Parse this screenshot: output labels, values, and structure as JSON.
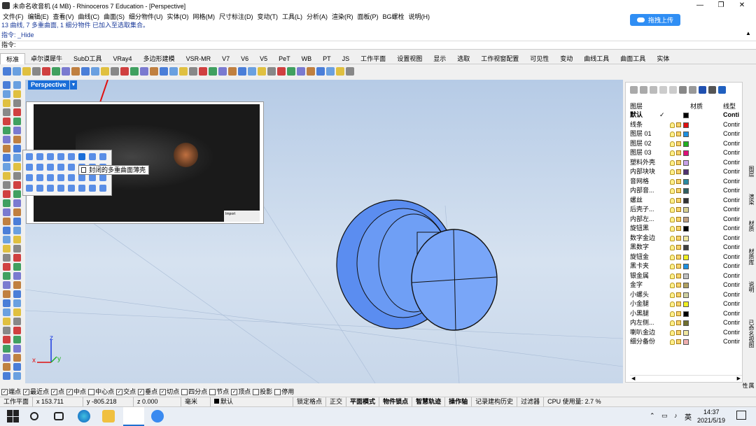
{
  "window": {
    "title": "未命名收音机 (4 MB) - Rhinoceros 7 Education - [Perspective]"
  },
  "menu": [
    "文件(F)",
    "编辑(E)",
    "查看(V)",
    "曲线(C)",
    "曲面(S)",
    "细分物件(U)",
    "实体(O)",
    "网格(M)",
    "尺寸标注(D)",
    "变动(T)",
    "工具(L)",
    "分析(A)",
    "渲染(R)",
    "面板(P)",
    "BG螺栓",
    "说明(H)"
  ],
  "command": {
    "line1": "13 曲线, 7 多重曲面, 1 细分物件 已加入至选取集合。",
    "line2": "指令: _Hide",
    "prompt": "指令:"
  },
  "upload_button": "拖拽上传",
  "tabs": [
    "标准",
    "卓尔谟犀牛",
    "SubD工具",
    "VRay4",
    "多边形建模",
    "VSR-MR",
    "V7",
    "V6",
    "V5",
    "PeT",
    "WB",
    "PT",
    "JS",
    "工作平面",
    "设置视图",
    "显示",
    "选取",
    "工作视窗配置",
    "可见性",
    "变动",
    "曲线工具",
    "曲面工具",
    "实体"
  ],
  "viewport": {
    "label": "Perspective",
    "axis_x": "x",
    "axis_y": "y",
    "axis_z": "z"
  },
  "tooltip": "封闭的多重曲面薄壳",
  "layers_panel": {
    "headers": {
      "name": "图层",
      "material": "材质",
      "linetype": "线型"
    },
    "rows": [
      {
        "name": "默认",
        "current": "✓",
        "color": "#000000",
        "linetype": "Conti"
      },
      {
        "name": "线条",
        "color": "#e01010",
        "linetype": "Contir"
      },
      {
        "name": "图层 01",
        "color": "#1e90e0",
        "linetype": "Contir"
      },
      {
        "name": "图层 02",
        "color": "#20b020",
        "linetype": "Contir"
      },
      {
        "name": "图层 03",
        "color": "#e0107a",
        "linetype": "Contir"
      },
      {
        "name": "塑料外壳",
        "color": "#c8a0e8",
        "linetype": "Contir"
      },
      {
        "name": "内部块块",
        "color": "#503070",
        "linetype": "Contir"
      },
      {
        "name": "音网格",
        "color": "#2a8aa0",
        "linetype": "Contir"
      },
      {
        "name": "内部音...",
        "color": "#306060",
        "linetype": "Contir"
      },
      {
        "name": "螺丝",
        "color": "#333333",
        "linetype": "Contir"
      },
      {
        "name": "后壳子...",
        "color": "#d8d090",
        "linetype": "Contir"
      },
      {
        "name": "内部左...",
        "color": "#c0a080",
        "linetype": "Contir"
      },
      {
        "name": "旋钮黑",
        "color": "#000000",
        "linetype": "Contir"
      },
      {
        "name": "数字金边",
        "color": "#f0e8a0",
        "linetype": "Contir"
      },
      {
        "name": "黑数字",
        "color": "#404040",
        "linetype": "Contir"
      },
      {
        "name": "旋钮金",
        "color": "#f0f020",
        "linetype": "Contir"
      },
      {
        "name": "黑卡夹",
        "color": "#1e90e0",
        "linetype": "Contir"
      },
      {
        "name": "银金属",
        "color": "#c0c0c0",
        "linetype": "Contir"
      },
      {
        "name": "金字",
        "color": "#b0a060",
        "linetype": "Contir"
      },
      {
        "name": "小螺头",
        "color": "#d0d0a0",
        "linetype": "Contir"
      },
      {
        "name": "小金腿",
        "color": "#f0f020",
        "linetype": "Contir"
      },
      {
        "name": "小黑腿",
        "color": "#000000",
        "linetype": "Contir"
      },
      {
        "name": "内左侧...",
        "color": "#707030",
        "linetype": "Contir"
      },
      {
        "name": "喇叭金边",
        "color": "#f0e8a0",
        "linetype": "Contir"
      },
      {
        "name": "细分备份",
        "color": "#f0b0b0",
        "linetype": "Contir"
      }
    ]
  },
  "right_tabs": [
    "图层",
    "渲染",
    "材质",
    "材质库",
    "说明",
    "已命名视图",
    "属性"
  ],
  "osnap": [
    {
      "label": "端点",
      "checked": true
    },
    {
      "label": "最近点",
      "checked": true
    },
    {
      "label": "点",
      "checked": true
    },
    {
      "label": "中点",
      "checked": true
    },
    {
      "label": "中心点",
      "checked": false
    },
    {
      "label": "交点",
      "checked": true
    },
    {
      "label": "垂点",
      "checked": true
    },
    {
      "label": "切点",
      "checked": true
    },
    {
      "label": "四分点",
      "checked": false
    },
    {
      "label": "节点",
      "checked": false
    },
    {
      "label": "顶点",
      "checked": true
    },
    {
      "label": "投影",
      "checked": false
    },
    {
      "label": "停用",
      "checked": false
    }
  ],
  "status": {
    "plane": "工作平面",
    "x": "x 153.711",
    "y": "y -805.218",
    "z": "z 0.000",
    "unit": "毫米",
    "layer": "默认",
    "items": [
      "锁定格点",
      "正交",
      "平面模式",
      "物件锁点",
      "智慧轨迹",
      "操作轴",
      "记录建构历史",
      "过滤器"
    ],
    "cpu": "CPU 使用量: 2.7 %"
  },
  "taskbar": {
    "time": "14:37",
    "date": "2021/5/19",
    "lang": "英"
  },
  "preview_thumb": "Import"
}
